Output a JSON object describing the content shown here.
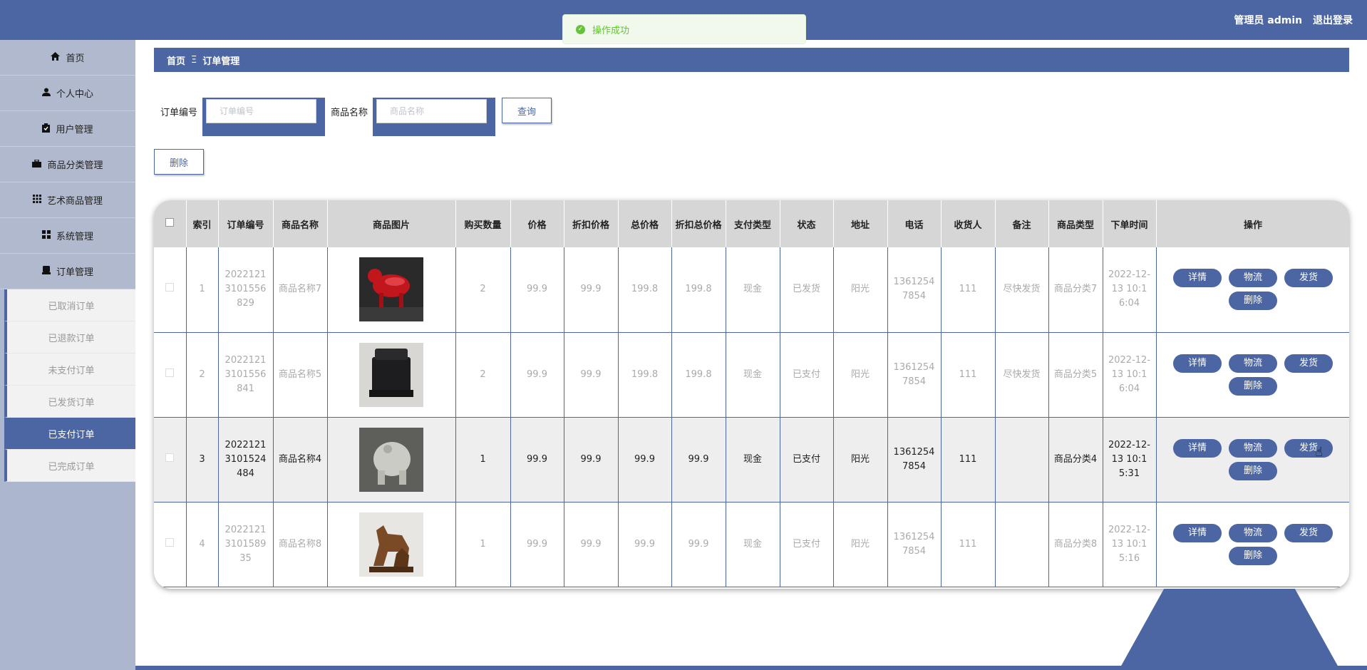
{
  "header": {
    "user_label": "管理员 admin",
    "logout_label": "退出登录"
  },
  "toast": {
    "message": "操作成功"
  },
  "sidebar": {
    "items": [
      {
        "label": "首页",
        "icon": "home-icon"
      },
      {
        "label": "个人中心",
        "icon": "user-icon"
      },
      {
        "label": "用户管理",
        "icon": "clipboard-icon"
      },
      {
        "label": "商品分类管理",
        "icon": "briefcase-icon"
      },
      {
        "label": "艺术商品管理",
        "icon": "grid-icon"
      },
      {
        "label": "系统管理",
        "icon": "apps-icon"
      },
      {
        "label": "订单管理",
        "icon": "order-icon"
      }
    ],
    "sub_items": [
      "已取消订单",
      "已退款订单",
      "未支付订单",
      "已发货订单",
      "已支付订单",
      "已完成订单"
    ],
    "active_sub": "已支付订单"
  },
  "breadcrumb": {
    "home": "首页",
    "separator": "Ξ",
    "current": "订单管理"
  },
  "search": {
    "order_no_label": "订单编号",
    "order_no_placeholder": "订单编号",
    "order_no_value": "",
    "product_label": "商品名称",
    "product_placeholder": "商品名称",
    "product_value": "",
    "query_label": "查询"
  },
  "toolbar": {
    "delete_label": "删除"
  },
  "table": {
    "headers": [
      "索引",
      "订单编号",
      "商品名称",
      "商品图片",
      "购买数量",
      "价格",
      "折扣价格",
      "总价格",
      "折扣总价格",
      "支付类型",
      "状态",
      "地址",
      "电话",
      "收货人",
      "备注",
      "商品类型",
      "下单时间",
      "操作"
    ],
    "action_labels": {
      "detail": "详情",
      "logistics": "物流",
      "ship": "发货",
      "delete": "删除"
    },
    "rows": [
      {
        "index": "1",
        "order_no": "20221213101556829",
        "product": "商品名称7",
        "image": "red-horse-figurine",
        "qty": "2",
        "price": "99.9",
        "discount_price": "99.9",
        "total": "199.8",
        "discount_total": "199.8",
        "pay_type": "现金",
        "status": "已发货",
        "address": "阳光",
        "phone": "13612547854",
        "receiver": "111",
        "remark": "尽快发货",
        "category": "商品分类7",
        "order_time": "2022-12-13 10:16:04"
      },
      {
        "index": "2",
        "order_no": "20221213101556841",
        "product": "商品名称5",
        "image": "black-stone-seal",
        "qty": "2",
        "price": "99.9",
        "discount_price": "99.9",
        "total": "199.8",
        "discount_total": "199.8",
        "pay_type": "现金",
        "status": "已支付",
        "address": "阳光",
        "phone": "13612547854",
        "receiver": "111",
        "remark": "尽快发货",
        "category": "商品分类5",
        "order_time": "2022-12-13 10:16:04"
      },
      {
        "index": "3",
        "order_no": "20221213101524484",
        "product": "商品名称4",
        "image": "white-elephant-figurine",
        "qty": "1",
        "price": "99.9",
        "discount_price": "99.9",
        "total": "99.9",
        "discount_total": "99.9",
        "pay_type": "现金",
        "status": "已支付",
        "address": "阳光",
        "phone": "13612547854",
        "receiver": "111",
        "remark": "",
        "category": "商品分类4",
        "order_time": "2022-12-13 10:15:31"
      },
      {
        "index": "4",
        "order_no": "2022121310158935",
        "product": "商品名称8",
        "image": "bronze-horses-sculpture",
        "qty": "1",
        "price": "99.9",
        "discount_price": "99.9",
        "total": "99.9",
        "discount_total": "99.9",
        "pay_type": "现金",
        "status": "已支付",
        "address": "阳光",
        "phone": "13612547854",
        "receiver": "111",
        "remark": "",
        "category": "商品分类8",
        "order_time": "2022-12-13 10:15:16"
      }
    ]
  },
  "colors": {
    "primary": "#4c66a3",
    "sidebar_bg": "#acb6cc",
    "toast_green": "#67c23a"
  }
}
